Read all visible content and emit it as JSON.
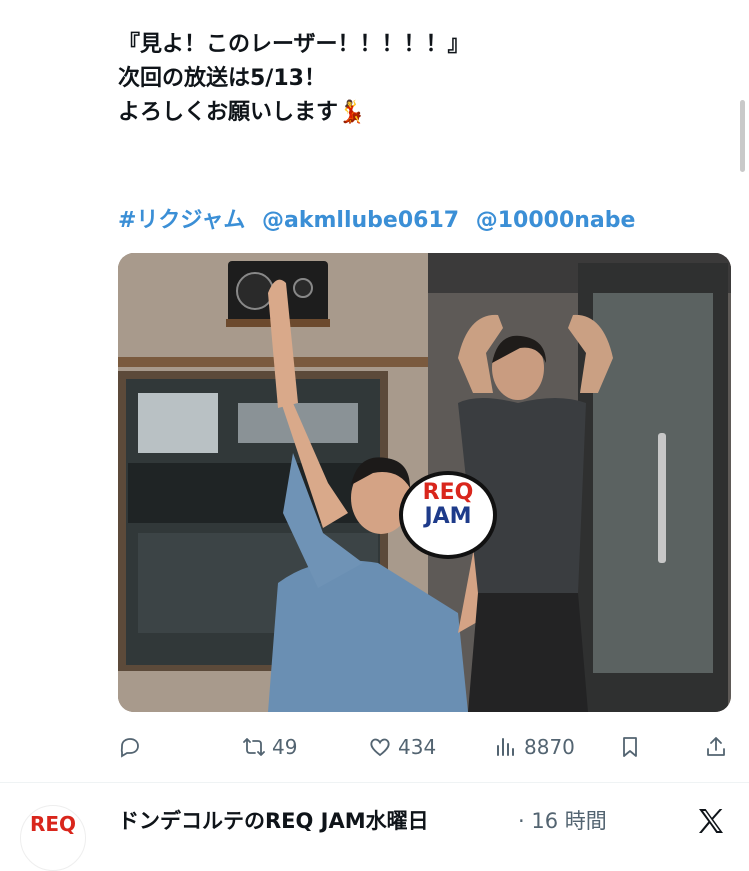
{
  "tweet": {
    "lines": [
      "『見よ！このレーザー！！！！！』",
      "次回の放送は5/13！",
      "よろしくお願いします💃"
    ],
    "hashtags": [
      "#リクジャム",
      "@akmllube0617",
      "@10000nabe"
    ]
  },
  "photo": {
    "sign_text_top": "REQ",
    "sign_text_bottom": "JAM"
  },
  "actions": {
    "reply": {
      "icon": "reply-icon",
      "count": ""
    },
    "retweet": {
      "icon": "retweet-icon",
      "count": "49"
    },
    "like": {
      "icon": "heart-icon",
      "count": "434"
    },
    "views": {
      "icon": "views-icon",
      "count": "8870"
    },
    "bookmark": {
      "icon": "bookmark-icon"
    },
    "share": {
      "icon": "share-icon"
    }
  },
  "next_tweet": {
    "author": "ドンデコルテのREQ JAM水曜日",
    "meta": "· 16 時間",
    "avatar_text": "REQ"
  },
  "colors": {
    "link": "#3b8fd6",
    "icon_gray": "#536471",
    "brand_red": "#d9261c"
  }
}
